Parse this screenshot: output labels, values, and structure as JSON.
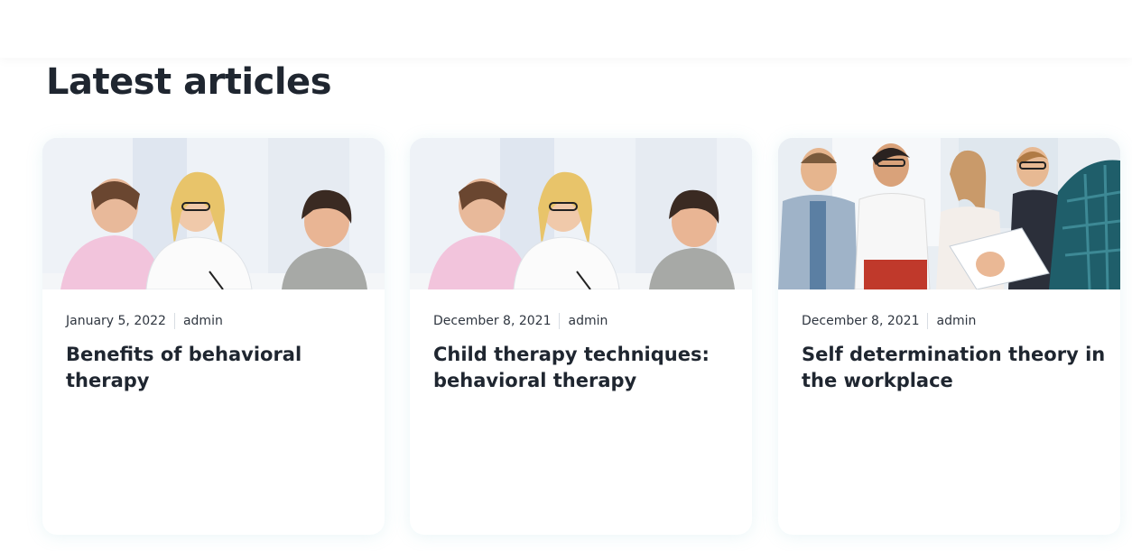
{
  "section": {
    "title": "Latest articles"
  },
  "articles": [
    {
      "date": "January 5, 2022",
      "author": "admin",
      "title": "Benefits of behavioral therapy",
      "image_icon": "therapy-session-photo"
    },
    {
      "date": "December 8, 2021",
      "author": "admin",
      "title": "Child therapy techniques: behavioral therapy",
      "image_icon": "therapy-session-photo"
    },
    {
      "date": "December 8, 2021",
      "author": "admin",
      "title": "Self determination theory in the workplace",
      "image_icon": "workplace-team-photo"
    }
  ],
  "colors": {
    "heading": "#1f2630",
    "text": "#2f3640",
    "card_shadow": "#8cc8d2"
  }
}
